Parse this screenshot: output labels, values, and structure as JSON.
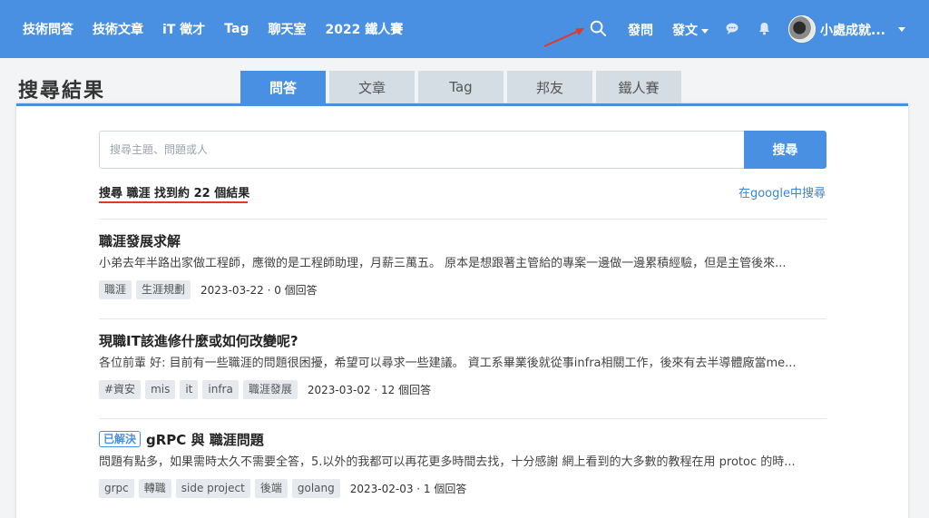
{
  "nav": {
    "left_links": [
      "技術問答",
      "技術文章",
      "iT 徵才",
      "Tag",
      "聊天室",
      "2022 鐵人賽"
    ],
    "ask_label": "發問",
    "post_label": "發文",
    "username": "小處成就..."
  },
  "page": {
    "title": "搜尋結果"
  },
  "tabs": [
    {
      "label": "問答",
      "active": true
    },
    {
      "label": "文章",
      "active": false
    },
    {
      "label": "Tag",
      "active": false
    },
    {
      "label": "邦友",
      "active": false
    },
    {
      "label": "鐵人賽",
      "active": false
    }
  ],
  "search": {
    "placeholder": "搜尋主題、問題或人",
    "value": "",
    "button_label": "搜尋"
  },
  "summary": {
    "text": "搜尋 職涯 找到約 22 個結果",
    "google_link": "在google中搜尋"
  },
  "results": [
    {
      "solved": false,
      "title": "職涯發展求解",
      "snippet": "小弟去年半路出家做工程師，應徵的是工程師助理，月薪三萬五。 原本是想跟著主管給的專案一邊做一邊累積經驗，但是主管後來...",
      "tags": [
        "職涯",
        "生涯規劃"
      ],
      "meta": "2023-03-22 · 0 個回答"
    },
    {
      "solved": false,
      "title": "現職IT該進修什麼或如何改變呢?",
      "snippet": "各位前輩 好: 目前有一些職涯的問題很困擾，希望可以尋求一些建議。 資工系畢業後就從事infra相關工作，後來有去半導體廠當me...",
      "tags": [
        "#資安",
        "mis",
        "it",
        "infra",
        "職涯發展"
      ],
      "meta": "2023-03-02 · 12 個回答"
    },
    {
      "solved": true,
      "solved_label": "已解決",
      "title": "gRPC 與 職涯問題",
      "snippet": "問題有點多，如果需時太久不需要全答，5.以外的我都可以再花更多時間去找，十分感謝 網上看到的大多數的教程在用 protoc 的時...",
      "tags": [
        "grpc",
        "轉職",
        "side project",
        "後端",
        "golang"
      ],
      "meta": "2023-02-03 · 1 個回答"
    }
  ],
  "colors": {
    "primary": "#4a90e2",
    "annotation": "#e0392b"
  }
}
